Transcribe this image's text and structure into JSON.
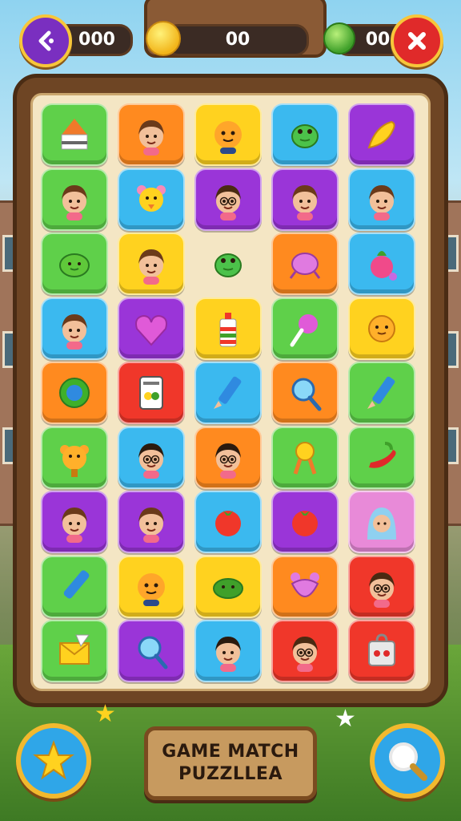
{
  "hud": {
    "left_counter": "000",
    "coin_counter": "00",
    "gem_counter": "00",
    "back_icon": "back-arrow-icon",
    "close_icon": "close-x-icon"
  },
  "title": {
    "line1": "GAME MATCH",
    "line2": "PUZZLLEA"
  },
  "buttons": {
    "left_icon": "star-icon",
    "right_icon": "magnifier-icon"
  },
  "colors": {
    "green": "#5fd04a",
    "orange": "#ff8a1f",
    "yellow": "#ffd21f",
    "blue": "#3bb9ef",
    "purple": "#9a35d8",
    "red": "#f0372a",
    "pink": "#e88ad8"
  },
  "tiles": [
    [
      "green:crayon-tip-icon",
      "orange:girl-face-icon",
      "yellow:orange-monster-icon",
      "blue:green-frog-icon",
      "purple:yellow-bird-icon"
    ],
    [
      "green:girl-face-icon",
      "blue:yellow-bear-icon",
      "purple:boy-glasses-icon",
      "purple:girl-face-icon",
      "blue:girl-face-icon"
    ],
    [
      "green:green-blob-icon",
      "yellow:girl-face-icon",
      "none:green-frog-icon",
      "orange:pink-blob-icon",
      "blue:radish-icon"
    ],
    [
      "blue:girl-face-icon",
      "purple:heart-icon",
      "yellow:bottle-icon",
      "green:lollipop-icon",
      "yellow:orange-blob-icon"
    ],
    [
      "orange:green-button-icon",
      "red:card-icon",
      "blue:pencil-icon",
      "orange:magnifier-icon",
      "green:pencil-icon"
    ],
    [
      "green:orange-bear-icon",
      "blue:girl-glasses-icon",
      "orange:girl-glasses-icon",
      "green:yellow-doll-icon",
      "green:chili-icon"
    ],
    [
      "purple:girl-face-icon",
      "purple:girl-face-icon",
      "blue:tomato-icon",
      "purple:tomato-icon",
      "pink:girl-hijab-icon"
    ],
    [
      "green:pen-icon",
      "yellow:orange-monster-icon",
      "yellow:turtle-icon",
      "orange:pink-bear-icon",
      "red:boy-glasses-icon"
    ],
    [
      "green:envelope-icon",
      "purple:magnifier-icon",
      "blue:boy-face-icon",
      "red:boy-glasses-icon",
      "red:red-bag-icon"
    ]
  ]
}
